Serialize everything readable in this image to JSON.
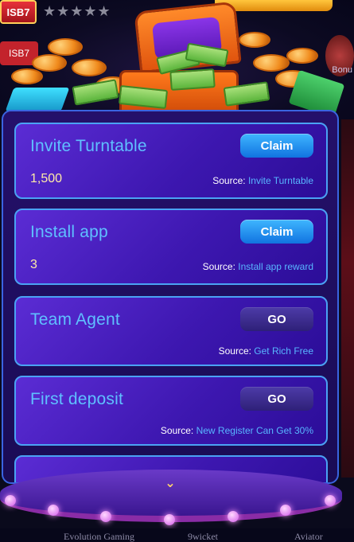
{
  "header": {
    "logo_text": "ISB7",
    "rating_stars": "★★★★★",
    "bonus_label": "Bonu"
  },
  "tasks": [
    {
      "title": "Invite Turntable",
      "amount": "1,500",
      "button": "Claim",
      "source_label": "Source:",
      "source_value": "Invite Turntable"
    },
    {
      "title": "Install app",
      "amount": "3",
      "button": "Claim",
      "source_label": "Source:",
      "source_value": "Install app reward"
    },
    {
      "title": "Team Agent",
      "amount": "",
      "button": "GO",
      "source_label": "Source:",
      "source_value": "Get Rich Free"
    },
    {
      "title": "First deposit",
      "amount": "",
      "button": "GO",
      "source_label": "Source:",
      "source_value": "New Register Can Get 30%"
    }
  ],
  "bottom_nav": {
    "item_1": "Evolution Gaming",
    "item_2": "9wicket",
    "item_3": "Aviator"
  },
  "colors": {
    "claim_button": "#1a8cf0",
    "go_button": "#3a2a90",
    "card_border": "#4aa2f4",
    "title_text": "#5fc0ff"
  }
}
